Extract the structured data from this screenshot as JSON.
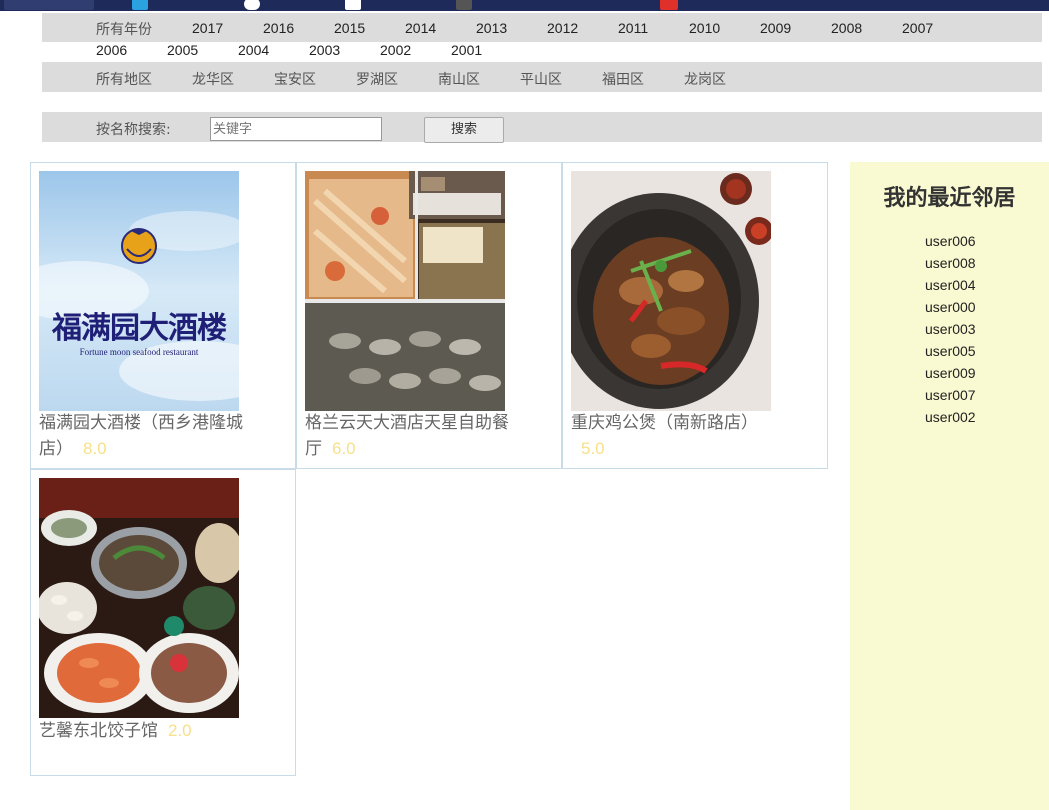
{
  "filters": {
    "year_label": "所有年份",
    "years_row1": [
      "2017",
      "2016",
      "2015",
      "2014",
      "2013",
      "2012",
      "2011",
      "2010",
      "2009",
      "2008",
      "2007"
    ],
    "years_row2": [
      "2006",
      "2005",
      "2004",
      "2003",
      "2002",
      "2001"
    ],
    "district_label": "所有地区",
    "districts": [
      "龙华区",
      "宝安区",
      "罗湖区",
      "南山区",
      "平山区",
      "福田区",
      "龙岗区"
    ]
  },
  "search": {
    "label": "按名称搜索:",
    "placeholder": "关键字",
    "button_label": "搜索"
  },
  "restaurants": [
    {
      "name": "福满园大酒楼（西乡港隆城店）",
      "score": "8.0",
      "logo_text": "福满园大酒楼",
      "logo_subtext": "Fortune moon seafood restaurant"
    },
    {
      "name": "格兰云天大酒店天星自助餐厅",
      "score": "6.0"
    },
    {
      "name": "重庆鸡公煲（南新路店）",
      "score": "5.0"
    },
    {
      "name": "艺馨东北饺子馆",
      "score": "2.0"
    }
  ],
  "sidebar": {
    "title": "我的最近邻居",
    "users": [
      "user006",
      "user008",
      "user004",
      "user000",
      "user003",
      "user005",
      "user009",
      "user007",
      "user002"
    ]
  }
}
